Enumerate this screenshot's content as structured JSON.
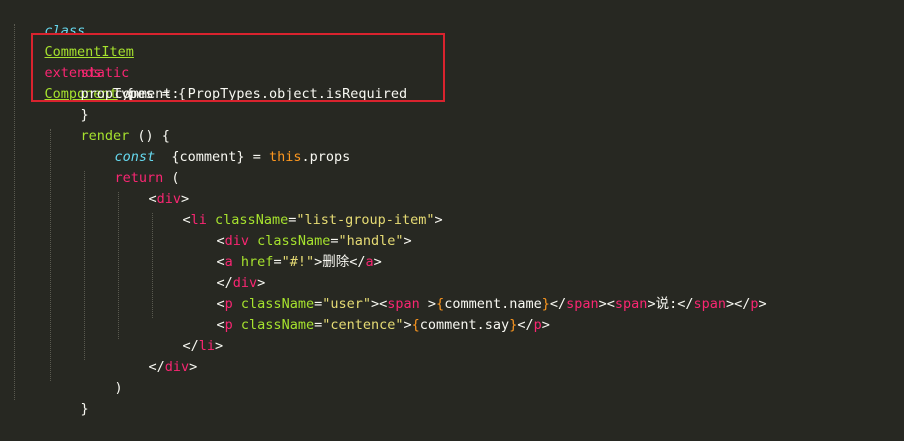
{
  "code": {
    "l1": {
      "class_kw": "class",
      "class_name": "CommentItem",
      "extends_kw": "extends",
      "parent": "Component",
      "brace": " {"
    },
    "l2": {
      "static_kw": "static",
      "name": "propTypes",
      "eq": " = {"
    },
    "l3": {
      "text": "comment: PropTypes.object.isRequired"
    },
    "l4": {
      "text": "}"
    },
    "l5": {
      "name": "render",
      "rest": " () {"
    },
    "l6": {
      "const_kw": "const",
      "rest": "  {comment} = ",
      "this_kw": "this",
      ".props": ".props"
    },
    "l7": {
      "return_kw": "return",
      "rest": " ("
    },
    "l8": {
      "open": "<",
      "tag": "div",
      "close": ">"
    },
    "l9": {
      "open": "<",
      "tag": "li",
      "attr": " className",
      "eq": "=",
      "val": "\"list-group-item\"",
      "close": ">"
    },
    "l10": {
      "open": "<",
      "tag": "div",
      "attr": " className",
      "eq": "=",
      "val": "\"handle\"",
      "close": ">"
    },
    "l11": {
      "open": "<",
      "tag": "a",
      "attr": " href",
      "eq": "=",
      "val": "\"#!\"",
      "mid": ">删除</",
      "tag2": "a",
      "close": ">"
    },
    "l12": {
      "open": "</",
      "tag": "div",
      "close": ">"
    },
    "l13": {
      "open": "<",
      "tag": "p",
      "attr": " className",
      "eq": "=",
      "val": "\"user\"",
      "m1": "><",
      "tag2": "span",
      "m2": " >",
      "b1": "{",
      "expr1": "comment.name",
      "b2": "}",
      "m3": "</",
      "tag3": "span",
      "m4": "><",
      "tag4": "span",
      "m5": ">说:</",
      "tag5": "span",
      "m6": "></",
      "tag6": "p",
      "close": ">"
    },
    "l14": {
      "open": "<",
      "tag": "p",
      "attr": " className",
      "eq": "=",
      "val": "\"centence\"",
      "m1": ">",
      "b1": "{",
      "expr1": "comment.say",
      "b2": "}",
      "m2": "</",
      "tag2": "p",
      "close": ">"
    },
    "l15": {
      "open": "</",
      "tag": "li",
      "close": ">"
    },
    "l16": {
      "open": "</",
      "tag": "div",
      "close": ">"
    },
    "l17": {
      "text": ")"
    },
    "l18": {
      "text": "}"
    }
  },
  "colors": {
    "background": "#272822",
    "keyword": "#f92672",
    "type": "#66d9ef",
    "class_name": "#a6e22e",
    "string": "#e6db74",
    "variable": "#fd971f",
    "highlight_box": "#d9232e"
  }
}
